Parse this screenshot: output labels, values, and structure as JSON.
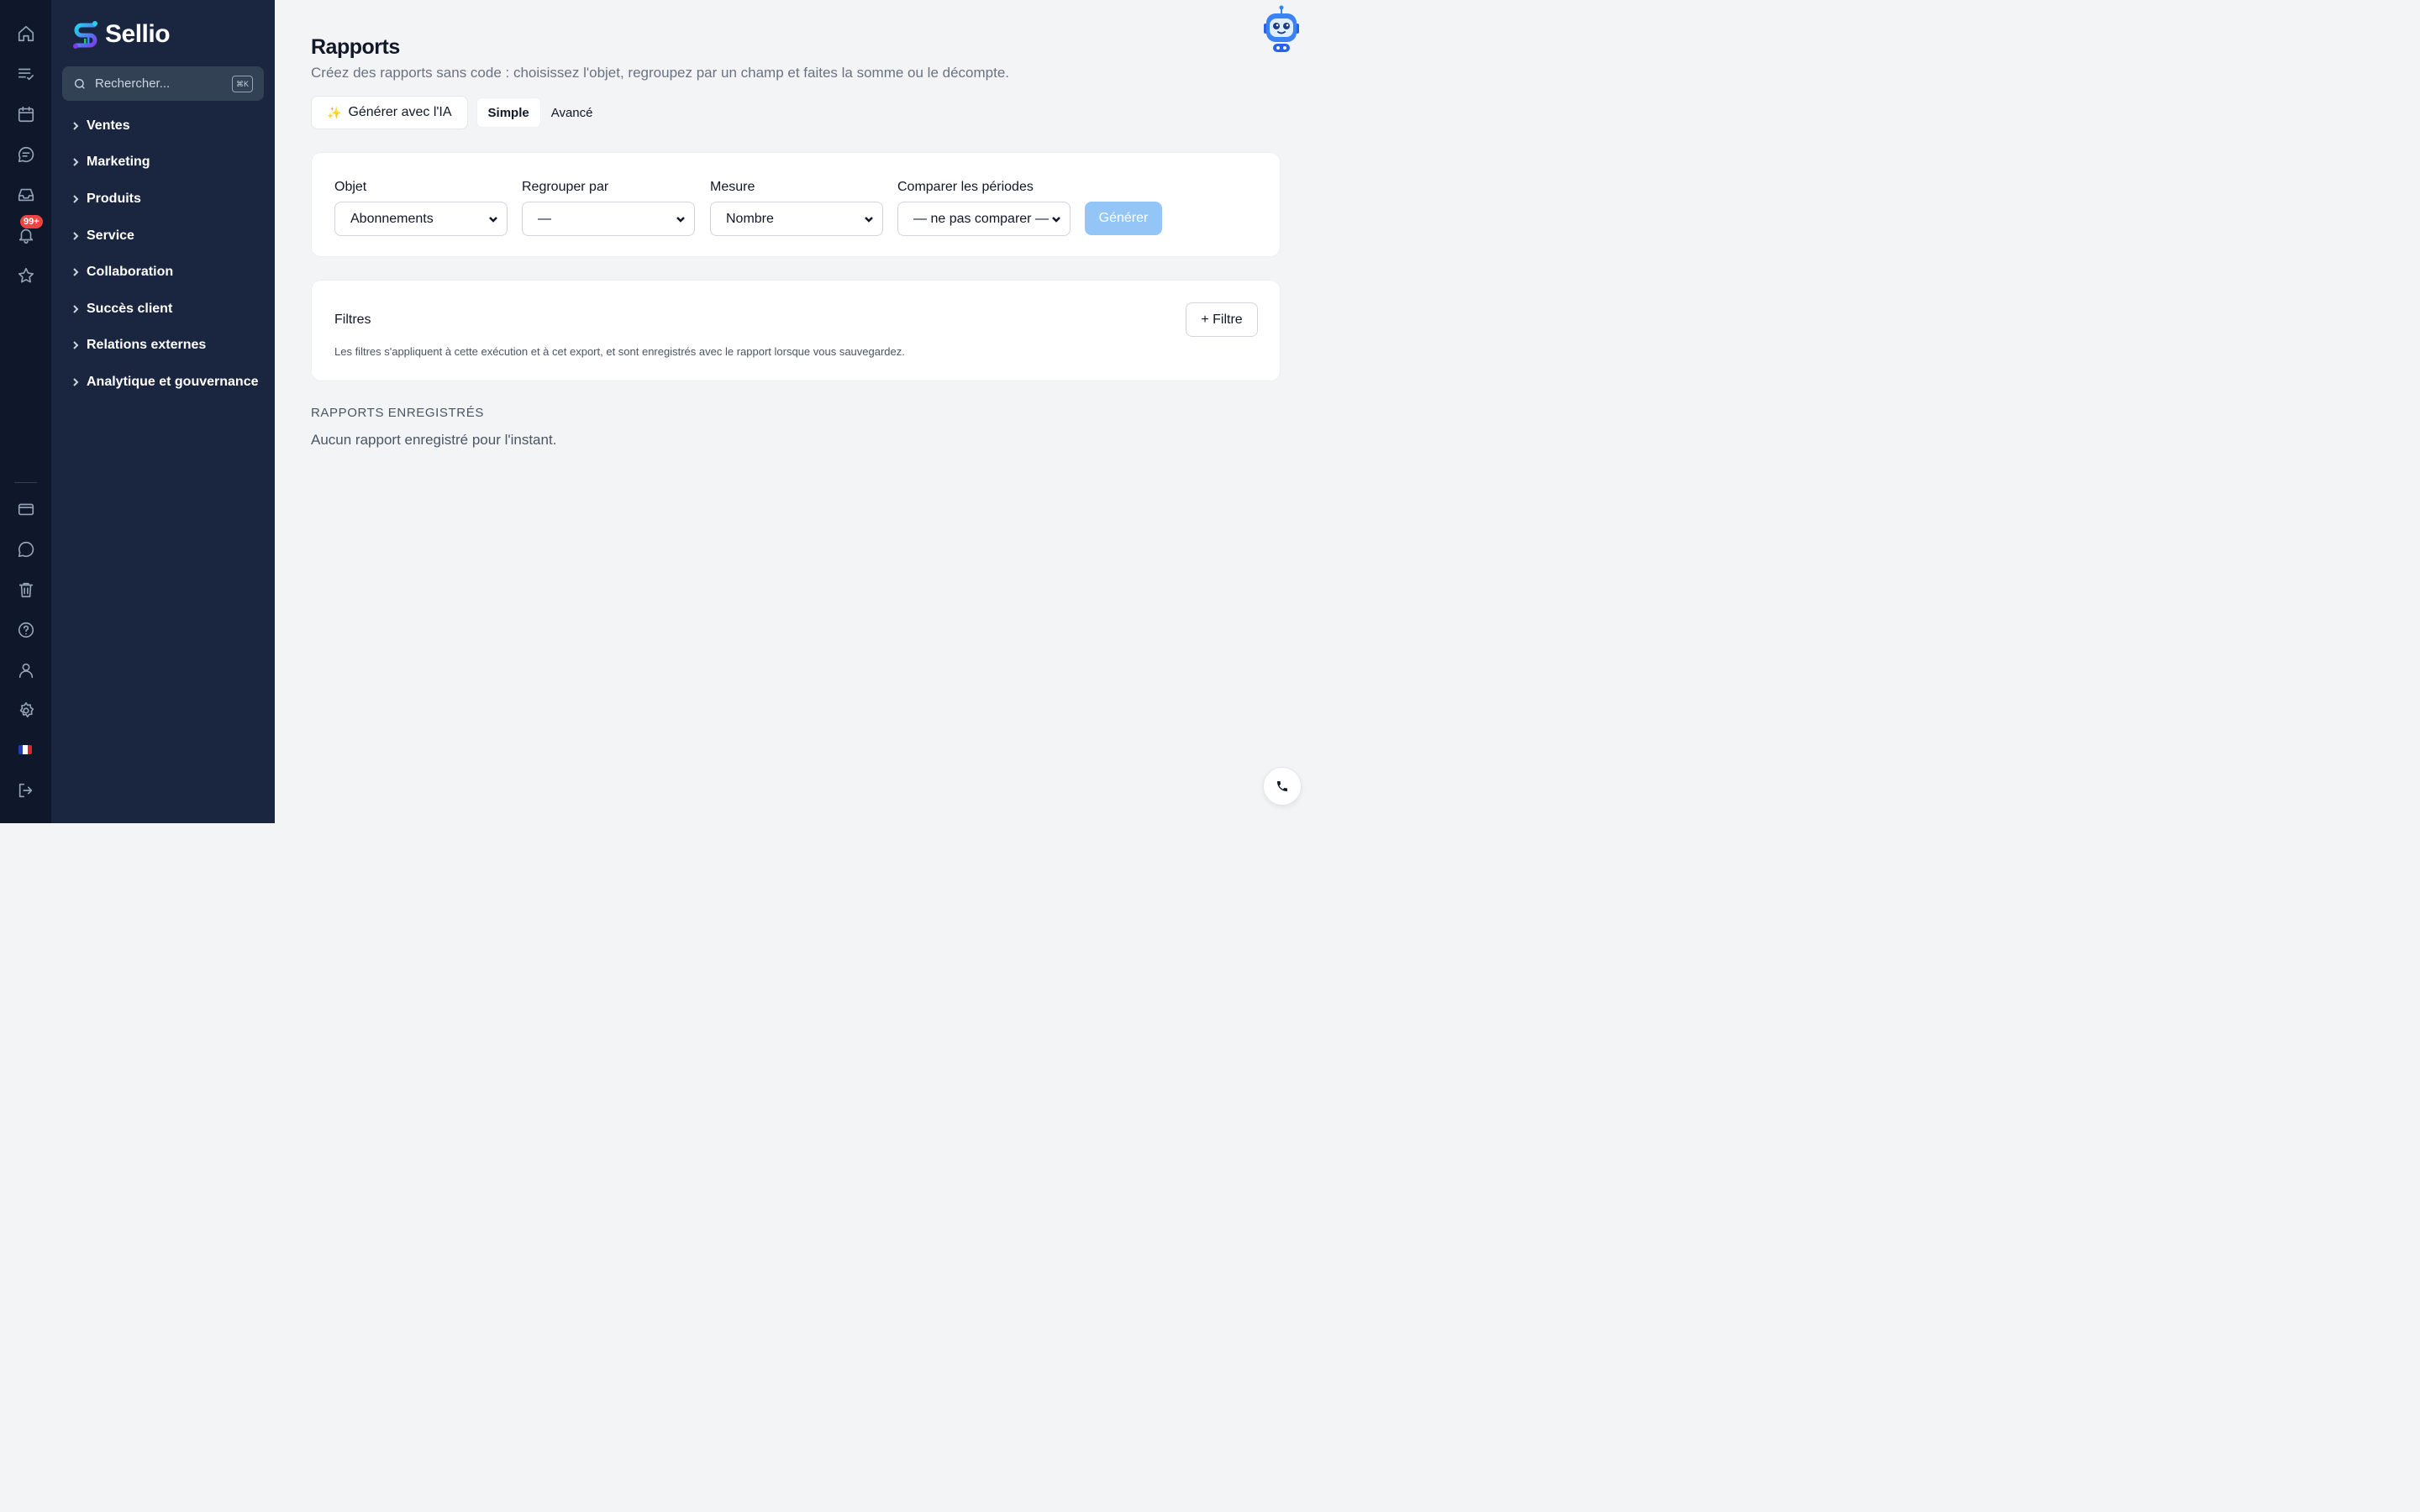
{
  "app": {
    "name": "Sellio"
  },
  "rail": {
    "top_icons": [
      "home-icon",
      "tasks-icon",
      "calendar-icon",
      "chat-icon",
      "inbox-icon",
      "bell-icon",
      "star-icon"
    ],
    "notification_badge": "99+",
    "bottom_icons": [
      "card-icon",
      "message-icon",
      "trash-icon",
      "help-icon",
      "user-icon",
      "gear-icon",
      "flag-fr-icon",
      "logout-icon"
    ]
  },
  "sidebar": {
    "search_placeholder": "Rechercher...",
    "search_shortcut": "⌘K",
    "items": [
      {
        "label": "Ventes"
      },
      {
        "label": "Marketing"
      },
      {
        "label": "Produits"
      },
      {
        "label": "Service"
      },
      {
        "label": "Collaboration"
      },
      {
        "label": "Succès client"
      },
      {
        "label": "Relations externes"
      },
      {
        "label": "Analytique et gouvernance"
      }
    ]
  },
  "page": {
    "title": "Rapports",
    "subtitle": "Créez des rapports sans code : choisissez l'objet, regroupez par un champ et faites la somme ou le décompte.",
    "ai_button": "Générer avec l'IA",
    "tabs": [
      {
        "label": "Simple",
        "active": true
      },
      {
        "label": "Avancé",
        "active": false
      }
    ]
  },
  "form": {
    "fields": [
      {
        "label": "Objet",
        "value": "Abonnements"
      },
      {
        "label": "Regrouper par",
        "value": "—"
      },
      {
        "label": "Mesure",
        "value": "Nombre"
      },
      {
        "label": "Comparer les périodes",
        "value": "— ne pas comparer —"
      }
    ],
    "generate_button": "Générer"
  },
  "filters": {
    "title": "Filtres",
    "add_button": "+ Filtre",
    "note": "Les filtres s'appliquent à cette exécution et à cet export, et sont enregistrés avec le rapport lorsque vous sauvegardez."
  },
  "saved": {
    "heading": "RAPPORTS ENREGISTRÉS",
    "empty_text": "Aucun rapport enregistré pour l'instant."
  },
  "colors": {
    "rail_bg": "#0f172a",
    "sidebar_bg": "#1a2540",
    "main_bg": "#f3f4f6",
    "primary_disabled": "#93c5f6",
    "badge": "#ef4444"
  }
}
